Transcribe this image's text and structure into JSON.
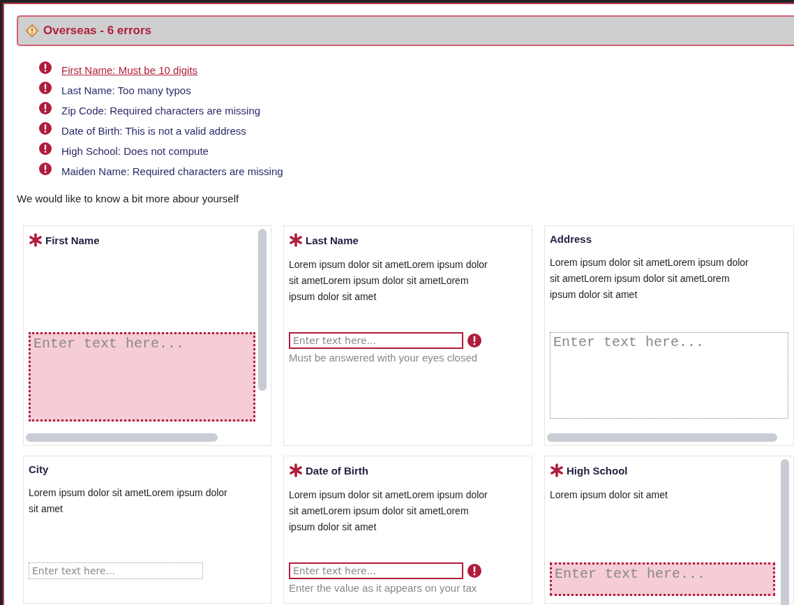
{
  "header": {
    "title": "Overseas - 6 errors"
  },
  "errors": [
    {
      "text": "First Name: Must be 10 digits",
      "link": true
    },
    {
      "text": "Last Name: Too many typos",
      "link": false
    },
    {
      "text": "Zip Code: Required characters are missing",
      "link": false
    },
    {
      "text": "Date of Birth: This is not a valid address",
      "link": false
    },
    {
      "text": "High School: Does not compute",
      "link": false
    },
    {
      "text": "Maiden Name: Required characters are missing",
      "link": false
    }
  ],
  "intro": "We would like to know a bit more abour yourself",
  "fields": [
    {
      "label": "First Name",
      "required": true,
      "kind": "textarea",
      "error": true,
      "placeholder": "Enter text here...",
      "scroll_vertical": true,
      "scroll_horizontal": true
    },
    {
      "label": "Last Name",
      "required": true,
      "description": "Lorem ipsum dolor sit ametLorem ipsum dolor sit ametLorem ipsum dolor sit ametLorem ipsum dolor sit amet",
      "kind": "input",
      "error": true,
      "placeholder": "Enter text here...",
      "hint": "Must be answered with your eyes closed",
      "scroll_vertical": false,
      "scroll_horizontal": false
    },
    {
      "label": "Address",
      "required": false,
      "description": "Lorem ipsum dolor sit ametLorem ipsum dolor sit ametLorem ipsum dolor sit ametLorem ipsum dolor sit amet",
      "kind": "textarea",
      "error": false,
      "placeholder": "Enter text here...",
      "scroll_vertical": false,
      "scroll_horizontal": true
    },
    {
      "label": "City",
      "required": false,
      "description": "Lorem ipsum dolor sit ametLorem ipsum dolor sit amet",
      "kind": "input",
      "error": false,
      "placeholder": "Enter text here...",
      "scroll_vertical": false,
      "scroll_horizontal": false
    },
    {
      "label": "Date of Birth",
      "required": true,
      "description": "Lorem ipsum dolor sit ametLorem ipsum dolor sit ametLorem ipsum dolor sit ametLorem ipsum dolor sit amet",
      "kind": "input",
      "error": true,
      "placeholder": "Enter text here...",
      "hint": "Enter the value as it appears on your tax",
      "scroll_vertical": false,
      "scroll_horizontal": false
    },
    {
      "label": "High School",
      "required": true,
      "description": "Lorem ipsum dolor sit amet",
      "kind": "textarea",
      "error": true,
      "placeholder": "Enter text here...",
      "scroll_vertical": true,
      "scroll_horizontal": false
    }
  ]
}
